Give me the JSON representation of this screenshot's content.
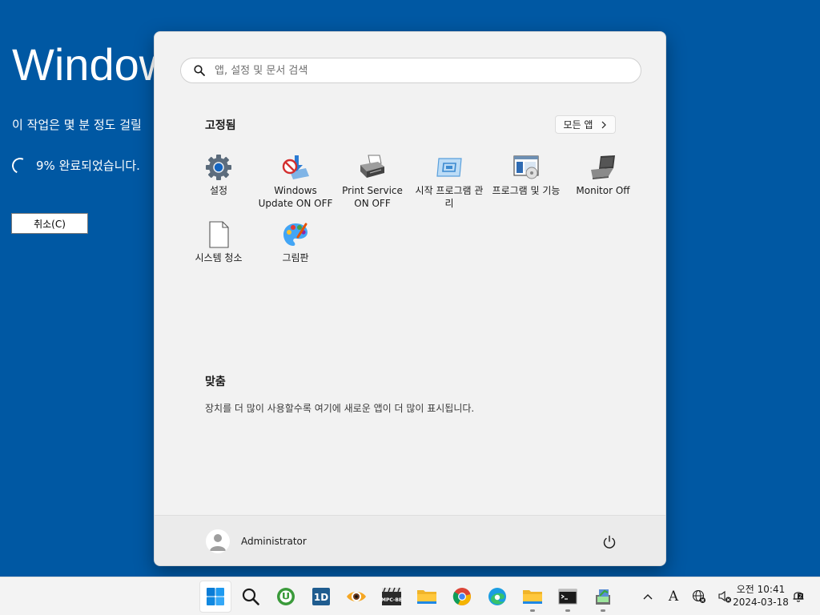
{
  "background": {
    "title": "Window",
    "description": "이 작업은 몇 분 정도 걸릴",
    "progress_text": "9% 완료되었습니다.",
    "cancel_label": "취소(C)"
  },
  "start_menu": {
    "search_placeholder": "앱, 설정 및 문서 검색",
    "pinned_title": "고정됨",
    "all_apps_label": "모든 앱",
    "pinned_apps": [
      {
        "label": "설정",
        "icon": "gear-icon"
      },
      {
        "label": "Windows Update ON OFF",
        "icon": "windows-update-icon"
      },
      {
        "label": "Print Service ON OFF",
        "icon": "printer-icon"
      },
      {
        "label": "시작 프로그램 관리",
        "icon": "startup-manager-icon"
      },
      {
        "label": "프로그램 및 기능",
        "icon": "programs-features-icon"
      },
      {
        "label": "Monitor Off",
        "icon": "laptop-icon"
      },
      {
        "label": "시스템 청소",
        "icon": "document-icon"
      },
      {
        "label": "그림판",
        "icon": "paint-palette-icon"
      }
    ],
    "recommended_title": "맞춤",
    "recommended_text": "장치를 더 많이 사용할수록 여기에 새로운 앱이 더 많이 표시됩니다.",
    "user_name": "Administrator"
  },
  "taskbar": {
    "apps": [
      {
        "name": "start",
        "icon": "windows-start-icon",
        "active": true,
        "running": false
      },
      {
        "name": "search",
        "icon": "search-icon",
        "active": false,
        "running": false
      },
      {
        "name": "utorrent",
        "icon": "utorrent-icon",
        "active": false,
        "running": false
      },
      {
        "name": "1d",
        "icon": "1d-app-icon",
        "active": false,
        "running": false
      },
      {
        "name": "image-viewer",
        "icon": "eye-viewer-icon",
        "active": false,
        "running": false
      },
      {
        "name": "mpc-be",
        "icon": "mpc-be-icon",
        "active": false,
        "running": false
      },
      {
        "name": "file-explorer",
        "icon": "folder-icon",
        "active": false,
        "running": false
      },
      {
        "name": "chrome",
        "icon": "chrome-icon",
        "active": false,
        "running": false
      },
      {
        "name": "edge",
        "icon": "edge-icon",
        "active": false,
        "running": false
      },
      {
        "name": "file-explorer-running",
        "icon": "folder-icon",
        "active": false,
        "running": true
      },
      {
        "name": "command-prompt",
        "icon": "terminal-icon",
        "active": false,
        "running": true
      },
      {
        "name": "setup",
        "icon": "setup-icon",
        "active": false,
        "running": true
      }
    ],
    "tray": {
      "ime_label": "A"
    },
    "clock": {
      "time": "오전 10:41",
      "date": "2024-03-18"
    }
  },
  "colors": {
    "desktop_bg": "#0058a3",
    "start_bg": "#f2f2f2",
    "taskbar_bg": "#f3f3f3"
  }
}
